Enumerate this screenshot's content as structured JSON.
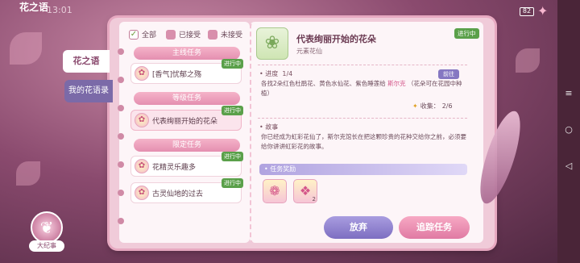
{
  "header": {
    "title": "花之语",
    "clock": "13:01",
    "battery": "82",
    "close_icon": "star-close-icon"
  },
  "nav": {
    "flower_language": "花之语",
    "flower_records": "我的花语录"
  },
  "filters": [
    {
      "label": "全部",
      "checked": true
    },
    {
      "label": "已接受",
      "checked": false
    },
    {
      "label": "未接受",
      "checked": false
    }
  ],
  "categories": {
    "main": "主线任务",
    "level": "等级任务",
    "limited": "限定任务"
  },
  "tasks": {
    "main_1": {
      "name": "[香气]忧郁之殇",
      "status": "进行中"
    },
    "level_1": {
      "name": "代表绚丽开始的花朵",
      "status": "进行中"
    },
    "limited_1": {
      "name": "花精灵乐趣多",
      "status": "进行中"
    },
    "limited_2": {
      "name": "古灵仙地的过去",
      "status": "进行中"
    }
  },
  "detail": {
    "title": "代表绚丽开始的花朵",
    "subtitle": "元素花仙",
    "status": "进行中",
    "progress_label": "进度",
    "progress_value": "1/4",
    "goto_label": "前往",
    "progress_text": "各找2朵红色杜鹃花、黄色水仙花、紫色睡莲给",
    "progress_npc": "斯尔克",
    "progress_tail": "（花朵可在花园中种植）",
    "collect_label": "收集：",
    "collect_value": "2/6",
    "story_label": "故事",
    "story_text": "你已经成为虹彩花仙了，斯尔克馆长在把这颗珍贵的花种交给你之前，必须要给你讲讲虹彩花的故事。",
    "reward_label": "任务奖励",
    "rewards": [
      {
        "icon": "flower-box-icon",
        "count": ""
      },
      {
        "icon": "gift-box-icon",
        "count": "2"
      }
    ]
  },
  "buttons": {
    "abandon": "放弃",
    "track": "追踪任务"
  },
  "emblem": {
    "label": "大纪事"
  },
  "colors": {
    "accent_pink": "#e07aa3",
    "accent_purple": "#7d6ec1",
    "status_green": "#5aa04a"
  }
}
